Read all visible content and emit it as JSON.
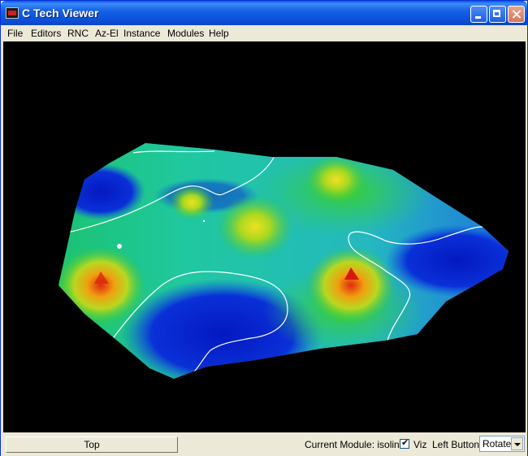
{
  "window": {
    "title": "C Tech Viewer"
  },
  "menu": [
    "File",
    "Editors",
    "RNC",
    "Az-El",
    "Instance",
    "Modules",
    "Help"
  ],
  "status": {
    "view_button": "Top",
    "current_module": "Current Module: isolines",
    "viz_label": "Viz",
    "viz_checked": true,
    "left_button_label": "Left Button",
    "left_button_value": "Rotate"
  },
  "colors": {
    "accent": "#0a58e6",
    "viewport_background": "#000000",
    "surface_low": "#0a2bd0",
    "surface_mid": "#2bd02b",
    "surface_high": "#e03a10",
    "isoline": "#ffffff"
  }
}
